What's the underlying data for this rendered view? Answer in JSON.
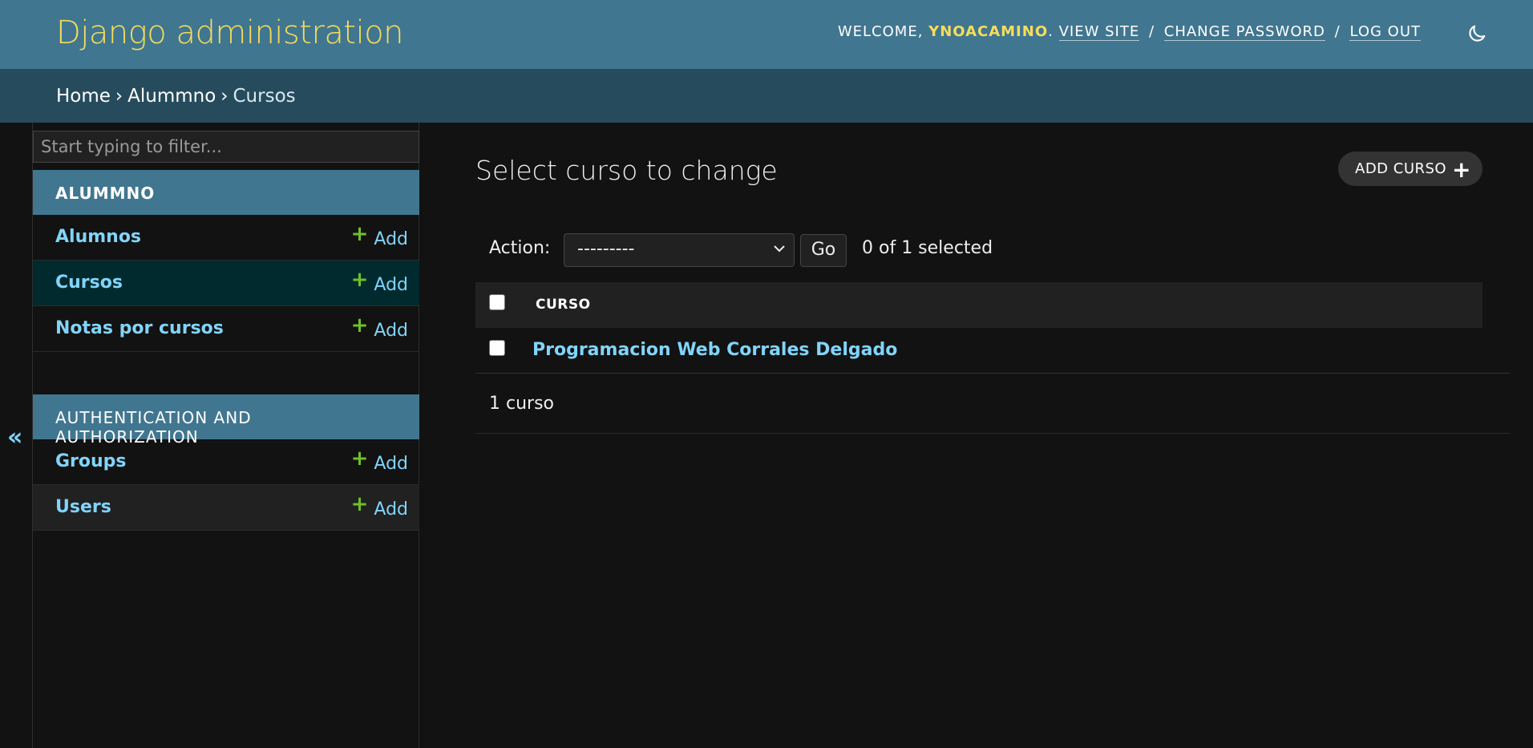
{
  "header": {
    "site_title": "Django administration",
    "welcome": "Welcome,",
    "username": "ynoacamino",
    "view_site": "View site",
    "change_password": "Change password",
    "log_out": "Log out",
    "separator": "/"
  },
  "breadcrumbs": {
    "home": "Home",
    "app": "Alummno",
    "current": "Cursos",
    "separator": "›"
  },
  "sidebar": {
    "filter_placeholder": "Start typing to filter...",
    "toggle": "«",
    "apps": [
      {
        "caption": "Alummno",
        "models": [
          {
            "name": "Alumnos",
            "add": "Add"
          },
          {
            "name": "Cursos",
            "add": "Add"
          },
          {
            "name": "Notas por cursos",
            "add": "Add"
          }
        ]
      },
      {
        "caption": "Authentication and Authorization",
        "models": [
          {
            "name": "Groups",
            "add": "Add"
          },
          {
            "name": "Users",
            "add": "Add"
          }
        ]
      }
    ]
  },
  "content": {
    "title": "Select curso to change",
    "add_button": "Add curso",
    "action_label": "Action:",
    "action_value": "---------",
    "go_label": "Go",
    "selected_count": "0 of 1 selected",
    "column_header": "Curso",
    "rows": [
      {
        "curso": "Programacion Web Corrales Delgado"
      }
    ],
    "paginator": "1 curso"
  },
  "colors": {
    "header_bg": "#417690",
    "breadcrumbs_bg": "#264b5d",
    "branding": "#f5dd5d",
    "link": "#81d4fa",
    "add_plus": "#70bf2b",
    "current_row": "#002a2e"
  }
}
